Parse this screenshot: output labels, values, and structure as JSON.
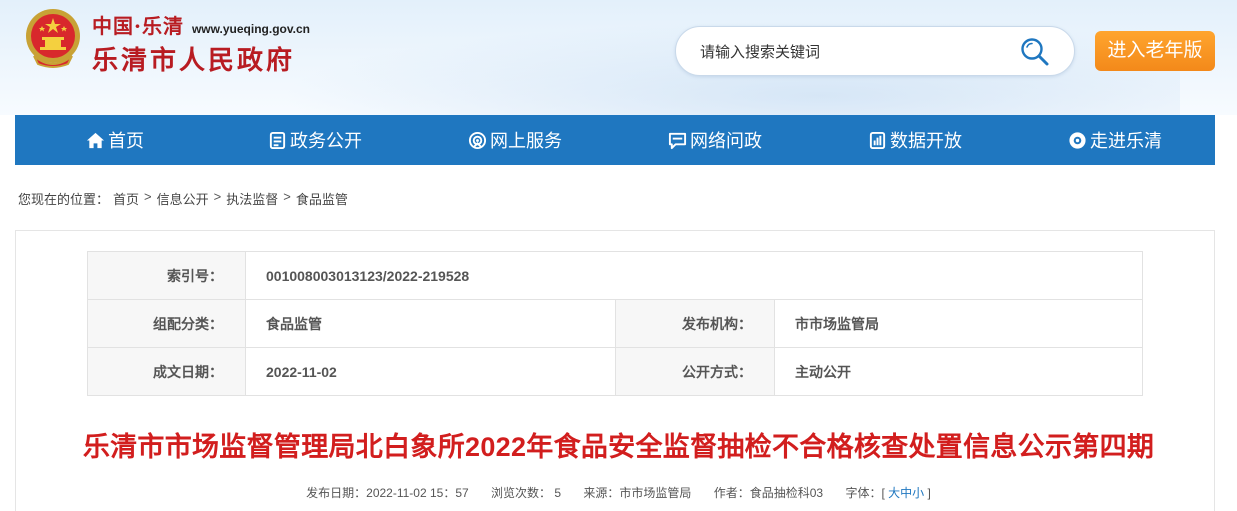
{
  "header": {
    "site_cn": "中国·乐清",
    "site_url": "www.yueqing.gov.cn",
    "site_name": "乐清市人民政府",
    "emblem_icon": "national-emblem-icon",
    "search": {
      "placeholder": "请输入搜索关键词",
      "icon": "search-icon"
    },
    "elder_mode_label": "进入老年版"
  },
  "nav": {
    "items": [
      {
        "label": "首页",
        "icon": "home-icon"
      },
      {
        "label": "政务公开",
        "icon": "document-icon"
      },
      {
        "label": "网上服务",
        "icon": "service-icon"
      },
      {
        "label": "网络问政",
        "icon": "chat-icon"
      },
      {
        "label": "数据开放",
        "icon": "data-icon"
      },
      {
        "label": "走进乐清",
        "icon": "eye-icon"
      }
    ]
  },
  "breadcrumb": {
    "prefix": "您现在的位置：",
    "items": [
      "首页",
      "信息公开",
      "执法监督",
      "食品监管"
    ],
    "separator": ">"
  },
  "meta": {
    "index_label": "索引号：",
    "index_value": "001008003013123/2022-219528",
    "category_label": "组配分类：",
    "category_value": "食品监管",
    "publisher_label": "发布机构：",
    "publisher_value": "市市场监管局",
    "date_label": "成文日期：",
    "date_value": "2022-11-02",
    "disclosure_label": "公开方式：",
    "disclosure_value": "主动公开"
  },
  "article": {
    "title": "乐清市市场监督管理局北白象所2022年食品安全监督抽检不合格核查处置信息公示第四期",
    "publish_date": "发布日期：2022-11-02 15：57",
    "views": "浏览次数： 5",
    "source": "来源：市市场监管局",
    "author": "作者：食品抽检科03",
    "font_label": "字体：[",
    "font_large": "大",
    "font_medium": "中",
    "font_small": "小",
    "font_end": "]"
  },
  "colors": {
    "brand_red": "#b81c22",
    "nav_blue": "#1f77c0",
    "title_red": "#d21e1e",
    "elder_orange": "#f3891a"
  }
}
